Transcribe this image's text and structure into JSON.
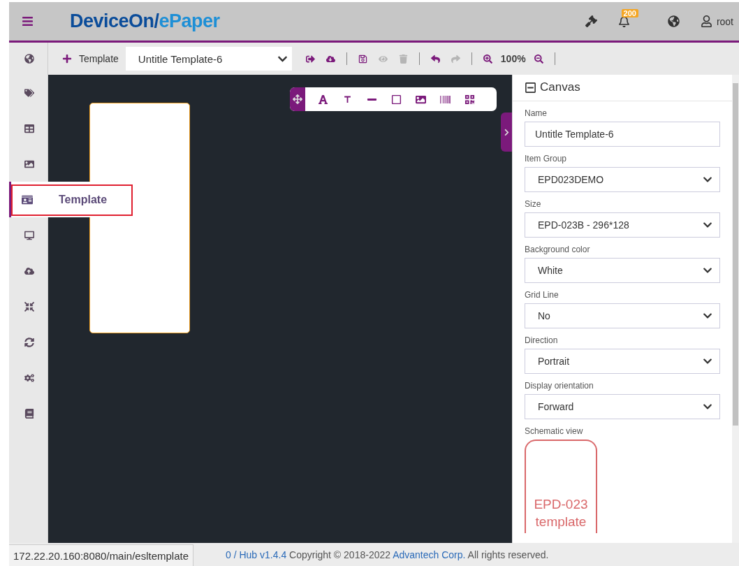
{
  "header": {
    "logo": {
      "primary": "DeviceOn/",
      "secondary": "ePaper"
    },
    "notification_count": "200",
    "user": "root"
  },
  "sidebar": {
    "items": [
      {
        "kind": "tags",
        "selected": false
      },
      {
        "kind": "table",
        "selected": false
      },
      {
        "kind": "image",
        "selected": false
      },
      {
        "kind": "template",
        "selected": true,
        "label": "Template"
      },
      {
        "kind": "monitor",
        "selected": false
      },
      {
        "kind": "upload",
        "selected": false
      },
      {
        "kind": "compress",
        "selected": false
      },
      {
        "kind": "sync",
        "selected": false
      },
      {
        "kind": "cogs",
        "selected": false
      },
      {
        "kind": "book",
        "selected": false
      }
    ]
  },
  "toolbar": {
    "add_label": "Template",
    "template_select": "Untitle Template-6",
    "zoom": "100%",
    "buttons": [
      {
        "kind": "export",
        "disabled": false
      },
      {
        "kind": "download",
        "disabled": false
      },
      {
        "kind": "divider"
      },
      {
        "kind": "save",
        "disabled": false
      },
      {
        "kind": "preview",
        "disabled": true
      },
      {
        "kind": "delete",
        "disabled": true
      },
      {
        "kind": "divider"
      },
      {
        "kind": "undo",
        "disabled": false
      },
      {
        "kind": "redo",
        "disabled": true
      },
      {
        "kind": "divider"
      },
      {
        "kind": "zoom-in",
        "disabled": false
      },
      {
        "kind": "zoom-level"
      },
      {
        "kind": "zoom-out",
        "disabled": false
      },
      {
        "kind": "divider"
      }
    ]
  },
  "canvas_tools": [
    {
      "kind": "text"
    },
    {
      "kind": "title"
    },
    {
      "kind": "line"
    },
    {
      "kind": "rectangle"
    },
    {
      "kind": "image"
    },
    {
      "kind": "barcode"
    },
    {
      "kind": "qrcode"
    }
  ],
  "panel": {
    "title": "Canvas",
    "expanded": true,
    "fields": [
      {
        "label": "Name",
        "kind": "input",
        "value": "Untitle Template-6"
      },
      {
        "label": "Item Group",
        "kind": "select",
        "value": "EPD023DEMO"
      },
      {
        "label": "Size",
        "kind": "select",
        "value": "EPD-023B - 296*128"
      },
      {
        "label": "Background color",
        "kind": "select",
        "value": "White"
      },
      {
        "label": "Grid Line",
        "kind": "select",
        "value": "No"
      },
      {
        "label": "Direction",
        "kind": "select",
        "value": "Portrait"
      },
      {
        "label": "Display orientation",
        "kind": "select",
        "value": "Forward"
      }
    ],
    "schematic": {
      "label": "Schematic view",
      "lines": [
        "EPD-023",
        "template"
      ]
    }
  },
  "footer": {
    "parts": [
      {
        "text": "0 / Hub v1.4.4",
        "link": true
      },
      {
        "text": "Copyright © 2018-2022",
        "link": false
      },
      {
        "text": "Advantech Corp.",
        "link": true
      },
      {
        "text": "All rights reserved.",
        "link": false
      }
    ],
    "status_url": "172.22.20.160:8080/main/esltemplate"
  }
}
